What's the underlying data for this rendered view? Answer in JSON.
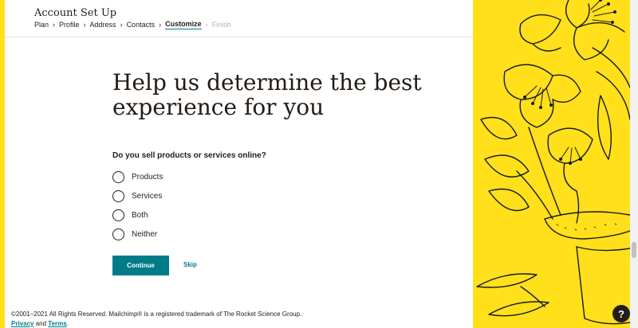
{
  "header": {
    "title": "Account Set Up",
    "breadcrumbs": [
      {
        "label": "Plan",
        "state": "done"
      },
      {
        "label": "Profile",
        "state": "done"
      },
      {
        "label": "Address",
        "state": "done"
      },
      {
        "label": "Contacts",
        "state": "done"
      },
      {
        "label": "Customize",
        "state": "active"
      },
      {
        "label": "Finish",
        "state": "disabled"
      }
    ]
  },
  "main": {
    "heading": "Help us determine the best experience for you",
    "question": "Do you sell products or services online?",
    "options": [
      {
        "label": "Products",
        "selected": false
      },
      {
        "label": "Services",
        "selected": false
      },
      {
        "label": "Both",
        "selected": false
      },
      {
        "label": "Neither",
        "selected": false
      }
    ],
    "continue_label": "Continue",
    "skip_label": "Skip"
  },
  "footer": {
    "copyright": "©2001–2021 All Rights Reserved. Mailchimp® is a registered trademark of The Rocket Science Group.",
    "privacy_label": "Privacy",
    "and_text": "and",
    "terms_label": "Terms",
    "end_text": "."
  },
  "help": {
    "label": "?"
  },
  "colors": {
    "accent": "#007c89",
    "brand_yellow": "#ffe01b",
    "text": "#241c15"
  },
  "icons": {
    "breadcrumb_separator": "chevron-right-icon",
    "help": "question-mark-icon",
    "illustration": "flower-plant-illustration"
  }
}
